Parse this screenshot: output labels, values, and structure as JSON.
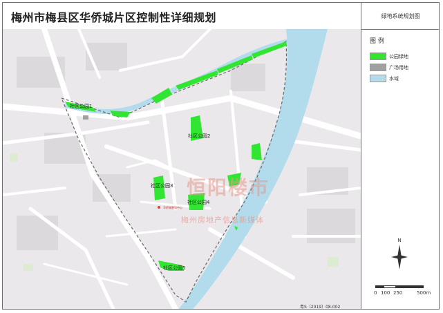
{
  "title": "梅州市梅县区华侨城片区控制性详细规划",
  "side_title": "绿地系统规划图",
  "legend": {
    "heading": "图 例",
    "items": [
      {
        "label": "公园绿地",
        "color": "#33e533"
      },
      {
        "label": "广场用地",
        "color": "#a0a0a0"
      },
      {
        "label": "水域",
        "color": "#b2dcec"
      }
    ]
  },
  "parks": [
    "社区公园1",
    "社区公园2",
    "社区公园3",
    "社区公园4",
    "社区公园5"
  ],
  "landmark": "华侨城营销中心",
  "compass_letter": "N",
  "scale_labels": [
    "0",
    "100",
    "250",
    "500m"
  ],
  "plan_number": "粤S（2019）08-002",
  "watermark": {
    "logo_text": "恒阳楼市",
    "subtitle": "梅州房地产信息新媒体"
  },
  "colors": {
    "map_bg": "#eae8ea",
    "water": "#b2dcec",
    "park": "#33e533",
    "road": "#ffffff",
    "boundary": "#666666"
  }
}
